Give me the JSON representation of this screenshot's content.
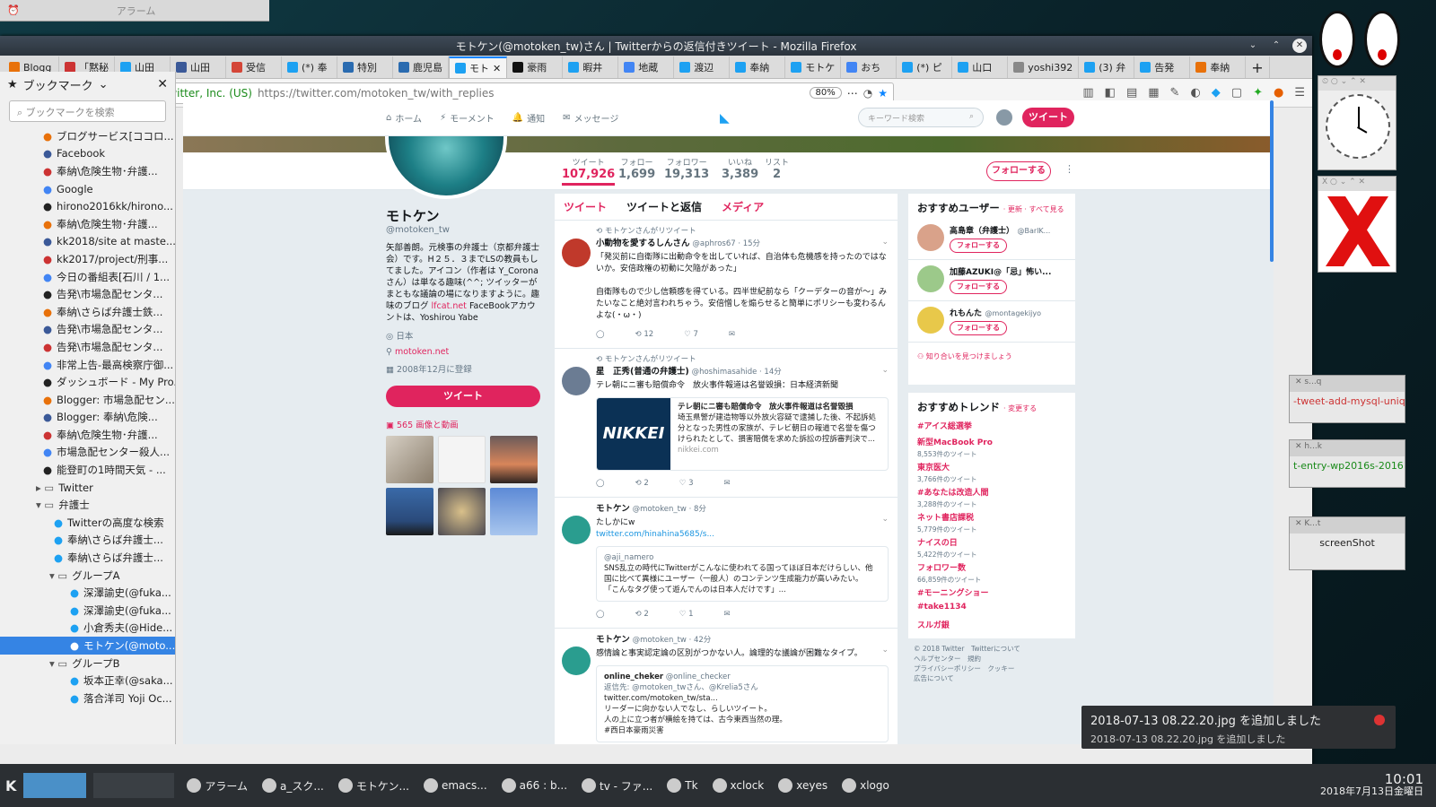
{
  "desktop": {
    "alarm_title": "アラーム"
  },
  "firefox": {
    "title": "モトケン(@motoken_tw)さん | Twitterからの返信付きツイート - Mozilla Firefox",
    "tabs": [
      "Blogg",
      "「黙秘",
      "山田",
      "山田",
      "受信",
      "(*) 奉",
      "特別",
      "鹿児島",
      "モト",
      "豪雨",
      "暇井",
      "地蔵",
      "渡辺",
      "奉納",
      "モトケ",
      "おち",
      "(*) ピ",
      "山口",
      "yoshi392",
      "(3) 弁",
      "告発",
      "奉納"
    ],
    "active_tab_index": 8,
    "identity": "Twitter, Inc. (US)",
    "url": "https://twitter.com/motoken_tw/with_replies",
    "zoom": "80%"
  },
  "sidebar": {
    "title": "ブックマーク",
    "search_placeholder": "ブックマークを検索",
    "items": [
      "ブログサービス[ココロ...",
      "Facebook",
      "奉納\\危険生物･弁護...",
      "Google",
      "hirono2016kk/hirono...",
      "奉納\\危険生物･弁護...",
      "kk2018/site at maste...",
      "kk2017/project/刑事...",
      "今日の番組表[石川 / 1...",
      "告発\\市場急配センタ...",
      "奉納\\さらば弁護士鉄...",
      "告発\\市場急配センタ...",
      "告発\\市場急配センタ...",
      "非常上告-最高検察庁御...",
      "ダッシュボード - My Pro...",
      "Blogger: 市場急配セン...",
      "Blogger: 奉納\\危険...",
      "奉納\\危険生物･弁護...",
      "市場急配センター殺人...",
      "能登町の1時間天気 - ...",
      "Twitter",
      "弁護士",
      "Twitterの高度な検索",
      "奉納\\さらば弁護士...",
      "奉納\\さらば弁護士...",
      "グループA",
      "深澤諭史(@fuka...",
      "深澤諭史(@fuka...",
      "小倉秀夫(@Hide...",
      "モトケン(@moto...",
      "グループB",
      "坂本正幸(@saka...",
      "落合洋司 Yoji Oc..."
    ]
  },
  "twitter": {
    "nav": [
      "ホーム",
      "モーメント",
      "通知",
      "メッセージ"
    ],
    "search_placeholder": "キーワード検索",
    "tweet_button": "ツイート",
    "stats": [
      {
        "label": "ツイート",
        "value": "107,926"
      },
      {
        "label": "フォロー",
        "value": "1,699"
      },
      {
        "label": "フォロワー",
        "value": "19,313"
      },
      {
        "label": "いいね",
        "value": "3,389"
      },
      {
        "label": "リスト",
        "value": "2"
      }
    ],
    "follow_button": "フォローする",
    "profile": {
      "name": "モトケン",
      "handle": "@motoken_tw",
      "bio": "矢部善朗。元検事の弁護士（京都弁護士会）です。H２５．３までLSの教員もしてました。アイコン（作者は Y_Coronaさん）は単なる趣味(^^; ツイッターがまともな議論の場になりますように。趣味のブログ",
      "bio_link": "lfcat.net",
      "bio_tail": "FaceBookアカウントは、Yoshirou Yabe",
      "location": "日本",
      "website": "motoken.net",
      "joined": "2008年12月に登録",
      "tweet_button": "ツイート",
      "media_label": "565 画像と動画"
    },
    "timeline_tabs": [
      "ツイート",
      "ツイートと返信",
      "メディア"
    ],
    "tweets": [
      {
        "rt": "モトケンさんがリツイート",
        "name": "小動物を愛するしんさん",
        "meta": "@aphros67 · 15分",
        "body": "「発災前に自衛隊に出動命令を出していれば、自治体も危機感を持ったのではないか。安倍政権の初動に欠陥があった」\n\n自衛隊もので少し信頼感を得ている。四半世紀前なら「クーデターの音が〜」みたいなこと絶対言われちゃう。安倍憎しを煽らせると簡単にポリシーも変わるんよな(・ω・)",
        "retweets": "12",
        "likes": "7"
      },
      {
        "rt": "モトケンさんがリツイート",
        "name": "星　正秀(普通の弁護士)",
        "meta": "@hoshimasahide · 14分",
        "body": "テレ朝にニ審も賠償命令　放火事件報道は名誉毀損：日本経済新聞",
        "card_title": "テレ朝にニ審も賠償命令　放火事件報道は名誉毀損",
        "card_body": "埼玉県警が建造物等以外放火容疑で逮捕した後、不起訴処分となった男性の家族が、テレビ朝日の報道で名誉を傷つけられたとして、損害賠償を求めた訴訟の控訴審判決で...",
        "card_domain": "nikkei.com",
        "card_logo": "NIKKEI",
        "retweets": "2",
        "likes": "3"
      },
      {
        "name": "モトケン",
        "meta": "@motoken_tw · 8分",
        "body": "たしかにw",
        "link": "twitter.com/hinahina5685/s...",
        "quote_handle": "@aji_namero",
        "quote_body": "SNS乱立の時代にTwitterがこんなに使われてる国ってほぼ日本だけらしい、他国に比べて異様にユーザー（一般人）のコンテンツ生成能力が高いみたい。\n「こんなタグ使って遊んでんのは日本人だけです」...",
        "retweets": "2",
        "likes": "1"
      },
      {
        "name": "モトケン",
        "meta": "@motoken_tw · 42分",
        "body": "感情論と事実認定論の区別がつかない人。論理的な議論が困難なタイプ。",
        "quote_name": "online_cheker",
        "quote_handle": "@online_checker",
        "quote_reply": "返信先: @motoken_twさん、@Krelia5さん",
        "quote_body": "twitter.com/motoken_tw/sta...\nリーダーに向かない人でなし、らしいツイート。\n人の上に立つ者が横絵を持ては、古今東西当然の理。\n#西日本豪雨災害"
      }
    ],
    "recommend": {
      "title": "おすすめユーザー",
      "links": "· 更新 · すべて見る",
      "users": [
        {
          "name": "高島章（弁護士）",
          "handle": "@BarlK..."
        },
        {
          "name": "加藤AZUKI@「忌」怖い...",
          "handle": ""
        },
        {
          "name": "れもんた",
          "handle": "@montagekijyo"
        }
      ],
      "follow": "フォローする",
      "find": "知り合いを見つけましょう"
    },
    "trends": {
      "title": "おすすめトレンド",
      "change": "· 変更する",
      "items": [
        {
          "tag": "#アイス総選挙",
          "count": ""
        },
        {
          "tag": "新型MacBook Pro",
          "count": "8,553件のツイート"
        },
        {
          "tag": "東京医大",
          "count": "3,766件のツイート"
        },
        {
          "tag": "#あなたは改造人間",
          "count": "3,288件のツイート"
        },
        {
          "tag": "ネット書店課税",
          "count": "5,779件のツイート"
        },
        {
          "tag": "ナイスの日",
          "count": "5,422件のツイート"
        },
        {
          "tag": "フォロワー数",
          "count": "66,859件のツイート"
        },
        {
          "tag": "#モーニングショー",
          "count": ""
        },
        {
          "tag": "#take1134",
          "count": ""
        },
        {
          "tag": "スルガ銀",
          "count": ""
        }
      ]
    },
    "footer": "© 2018 Twitter　Twitterについて\nヘルプセンター　規約\nプライバシーポリシー　クッキー\n広告について"
  },
  "side_windows": {
    "win1_title": "s...q",
    "win1_text": "-tweet-add-mysql-uniq.rl",
    "win2_title": "h...k",
    "win2_text": "t-entry-wp2016s-20161(",
    "win3_title": "K...t",
    "win3_button": "screenShot"
  },
  "notification": {
    "title": "2018-07-13 08.22.20.jpg を追加しました",
    "body": "2018-07-13 08.22.20.jpg を追加しました"
  },
  "taskbar": {
    "items": [
      "アラーム",
      "a_スク...",
      "モトケン...",
      "emacs...",
      "a66 : b...",
      "tv - ファ...",
      "Tk",
      "xclock",
      "xeyes",
      "xlogo"
    ],
    "time": "10:01",
    "date": "2018年7月13日金曜日"
  }
}
